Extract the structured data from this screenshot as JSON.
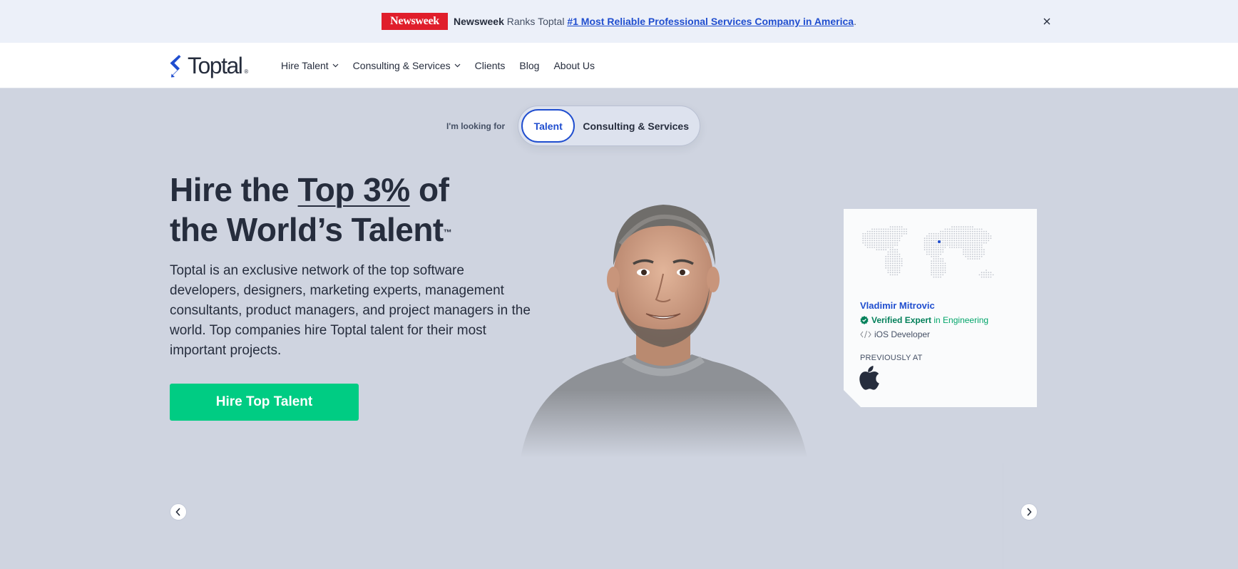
{
  "banner": {
    "logo_text": "Newsweek",
    "lead": "Newsweek",
    "middle": " Ranks Toptal ",
    "link": "#1 Most Reliable Professional Services Company in America",
    "trail": ".",
    "close_icon": "close-icon"
  },
  "header": {
    "logo": "Toptal",
    "logo_mark": "®",
    "nav": [
      {
        "label": "Hire Talent",
        "has_dropdown": true
      },
      {
        "label": "Consulting & Services",
        "has_dropdown": true
      },
      {
        "label": "Clients",
        "has_dropdown": false
      },
      {
        "label": "Blog",
        "has_dropdown": false
      },
      {
        "label": "About Us",
        "has_dropdown": false
      }
    ]
  },
  "toggle": {
    "label": "I'm looking for",
    "options": [
      "Talent",
      "Consulting & Services"
    ],
    "selected": "Talent"
  },
  "hero": {
    "title_part1": "Hire the ",
    "title_highlight": "Top 3%",
    "title_part2": " of",
    "title_line2": "the World’s Talent",
    "title_tm": "™",
    "description": "Toptal is an exclusive network of the top software developers, designers, marketing experts, management consultants, product managers, and project managers in the world. Top companies hire Toptal talent for their most important projects.",
    "cta": "Hire Top Talent"
  },
  "talent_card": {
    "name": "Vladimir Mitrovic",
    "verified_label": "Verified Expert",
    "verified_suffix": " in Engineering",
    "role": "iOS Developer",
    "previously_at": "PREVIOUSLY AT",
    "company_icon": "apple-logo-icon"
  },
  "carousel": {
    "prev_icon": "chevron-left-icon",
    "next_icon": "chevron-right-icon"
  },
  "colors": {
    "brand_blue": "#204ecf",
    "cta_green": "#00cc83",
    "hero_bg": "#cfd4e0",
    "banner_bg": "#ecf0f9",
    "newsweek_red": "#e01e2b"
  }
}
